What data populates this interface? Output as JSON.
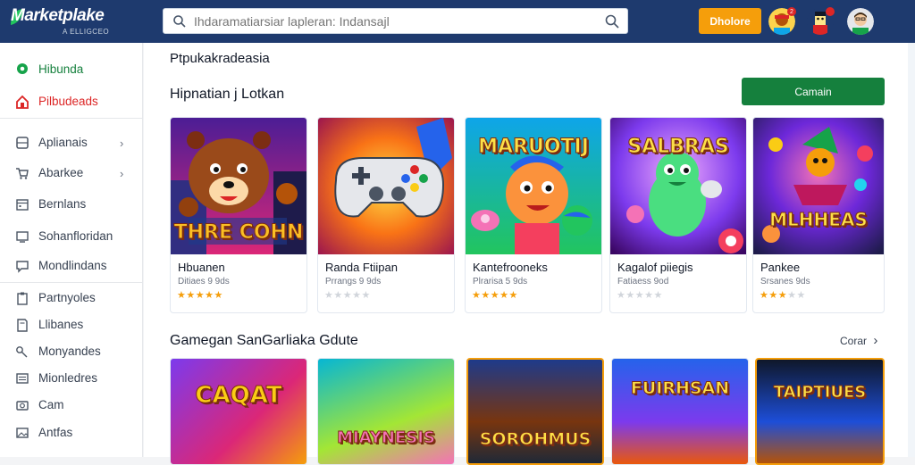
{
  "header": {
    "logo_text": "Marketplake",
    "logo_sub": "A ELLIGCEO",
    "search_placeholder": "Ihdaramatiarsiar lapleran: Indansajl",
    "action_button": "Dholore",
    "notification_count": "2",
    "colors": {
      "bar": "#1e3a6e",
      "action": "#f59e0b"
    }
  },
  "sidebar": {
    "items": [
      {
        "label": "Hibunda",
        "icon": "map-pin-icon",
        "color": "#16a34a"
      },
      {
        "label": "Pilbudeads",
        "icon": "home-icon",
        "color": "#dc2626"
      },
      {
        "label": "Aplianais",
        "icon": "grid-icon",
        "chevron": true
      },
      {
        "label": "Abarkee",
        "icon": "cart-icon",
        "chevron": true
      },
      {
        "label": "Bernlans",
        "icon": "calendar-icon"
      },
      {
        "label": "Sohanfloridan",
        "icon": "monitor-icon"
      },
      {
        "label": "Mondlindans",
        "icon": "chat-icon"
      },
      {
        "label": "Partnyoles",
        "icon": "clipboard-icon"
      },
      {
        "label": "Llibanes",
        "icon": "book-icon"
      },
      {
        "label": "Monyandes",
        "icon": "key-icon"
      },
      {
        "label": "Mionledres",
        "icon": "list-icon"
      },
      {
        "label": "Cam",
        "icon": "camera-icon"
      },
      {
        "label": "Antfas",
        "icon": "image-icon"
      }
    ]
  },
  "main": {
    "top_title": "Ptpukakradeasia",
    "section1_title": "Hipnatian j Lotkan",
    "section1_button": "Camain",
    "section2_title": "Gamegan SanGarliaka Gdute",
    "section2_more": "Corar",
    "cards": [
      {
        "title": "Hbuanen",
        "sub": "Ditiaes 9 9ds",
        "rating": 5,
        "art_text": "THRE COHN"
      },
      {
        "title": "Randa Ftiipan",
        "sub": "Prrangs 9 9ds",
        "rating": 0,
        "art_text": ""
      },
      {
        "title": "Kantefrooneks",
        "sub": "Plrarisa 5 9ds",
        "rating": 5,
        "art_text": "MARUOTIJ"
      },
      {
        "title": "Kagalof piiegis",
        "sub": "Fatiaess 9od",
        "rating": 0,
        "art_text": "SALBRAS"
      },
      {
        "title": "Pankee",
        "sub": "Srsanes 9ds",
        "rating": 3,
        "art_text": "MLHHEAS"
      }
    ],
    "cards2": [
      {
        "art_text": "CAQAT"
      },
      {
        "art_text": "MIAYNESIS"
      },
      {
        "art_text": "SOROHMUS"
      },
      {
        "art_text": "FUIRHSAN"
      },
      {
        "art_text": "TAIPTIUES"
      }
    ]
  }
}
